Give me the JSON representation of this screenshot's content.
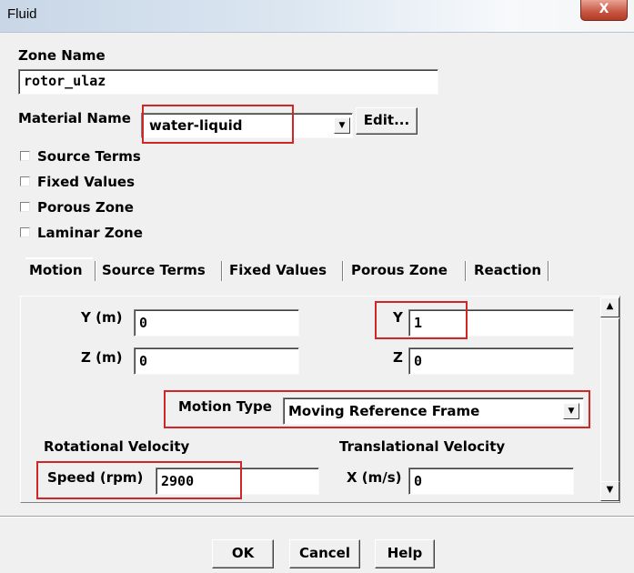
{
  "window": {
    "title": "Fluid",
    "close_glyph": "X"
  },
  "zone": {
    "label": "Zone Name",
    "value": "rotor_ulaz"
  },
  "material": {
    "label": "Material Name",
    "value": "water-liquid",
    "edit_label": "Edit..."
  },
  "options": [
    {
      "label": "Source Terms",
      "checked": false
    },
    {
      "label": "Fixed Values",
      "checked": false
    },
    {
      "label": "Porous Zone",
      "checked": false
    },
    {
      "label": "Laminar Zone",
      "checked": false
    }
  ],
  "tabs": [
    "Motion",
    "Source Terms",
    "Fixed Values",
    "Porous Zone",
    "Reaction"
  ],
  "active_tab": "Motion",
  "motion": {
    "origin": {
      "y_label": "Y (m)",
      "y_value": "0",
      "z_label": "Z (m)",
      "z_value": "0"
    },
    "axis": {
      "y_label": "Y",
      "y_value": "1",
      "z_label": "Z",
      "z_value": "0"
    },
    "motion_type": {
      "label": "Motion Type",
      "value": "Moving Reference Frame"
    },
    "rotational": {
      "title": "Rotational Velocity",
      "speed_label": "Speed (rpm)",
      "speed_value": "2900"
    },
    "translational": {
      "title": "Translational Velocity",
      "x_label": "X (m/s)",
      "x_value": "0"
    }
  },
  "buttons": {
    "ok": "OK",
    "cancel": "Cancel",
    "help": "Help"
  },
  "colors": {
    "highlight": "#d22525",
    "dialog": "#f0f0f0"
  }
}
